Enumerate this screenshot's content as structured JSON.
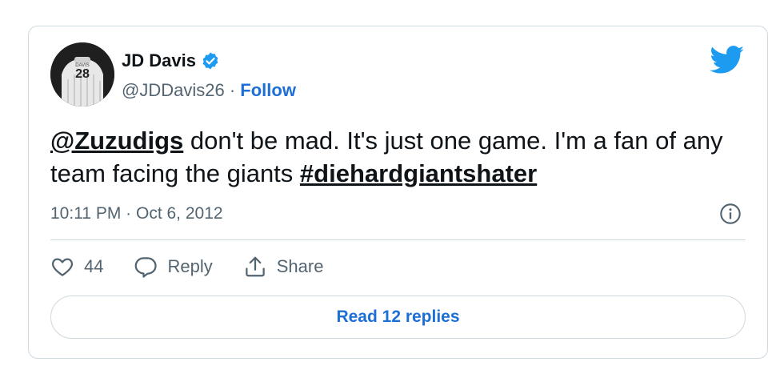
{
  "author": {
    "name": "JD Davis",
    "handle": "@JDDavis26",
    "separator": "·",
    "follow_label": "Follow",
    "jersey_number": "28",
    "verified": true
  },
  "tweet": {
    "mention": "@Zuzudigs",
    "body_1": " don't be mad. It's just one game. I'm a fan of any team facing the giants ",
    "hashtag": "#diehardgiantshater",
    "time": "10:11 PM",
    "separator": "·",
    "date": "Oct 6, 2012"
  },
  "actions": {
    "like_count": "44",
    "reply_label": "Reply",
    "share_label": "Share"
  },
  "read_replies_label": "Read 12 replies",
  "colors": {
    "accent": "#1d6fd6",
    "twitter_blue": "#1d9bf0",
    "text": "#0f1419",
    "muted": "#536471",
    "border": "#cfd9de"
  },
  "icons": [
    "verified-badge-icon",
    "twitter-bird-icon",
    "info-icon",
    "heart-icon",
    "reply-bubble-icon",
    "share-icon"
  ]
}
